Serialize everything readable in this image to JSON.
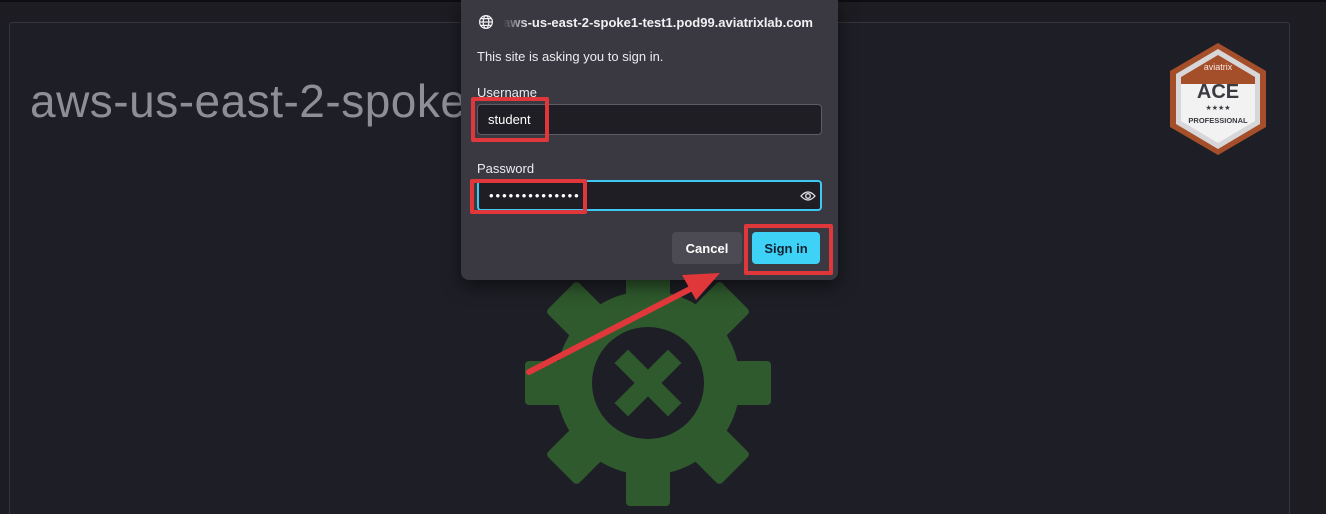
{
  "page": {
    "heading": "aws-us-east-2-spoke"
  },
  "badge": {
    "brand": "aviatrix",
    "title": "ACE",
    "stars": "★★★★",
    "level": "PROFESSIONAL",
    "accent_color": "#a54f2a"
  },
  "status_graphic": {
    "icon": "gear-error-icon",
    "color": "#2f5a2d"
  },
  "auth_dialog": {
    "site_url": "aws-us-east-2-spoke1-test1.pod99.aviatrixlab.com",
    "message": "This site is asking you to sign in.",
    "username_label": "Username",
    "username_value": "student",
    "password_label": "Password",
    "password_value": "••••••••••••••",
    "cancel_label": "Cancel",
    "signin_label": "Sign in",
    "signin_color": "#3fd2f7"
  },
  "annotations": {
    "highlight_color": "#e0383a"
  }
}
